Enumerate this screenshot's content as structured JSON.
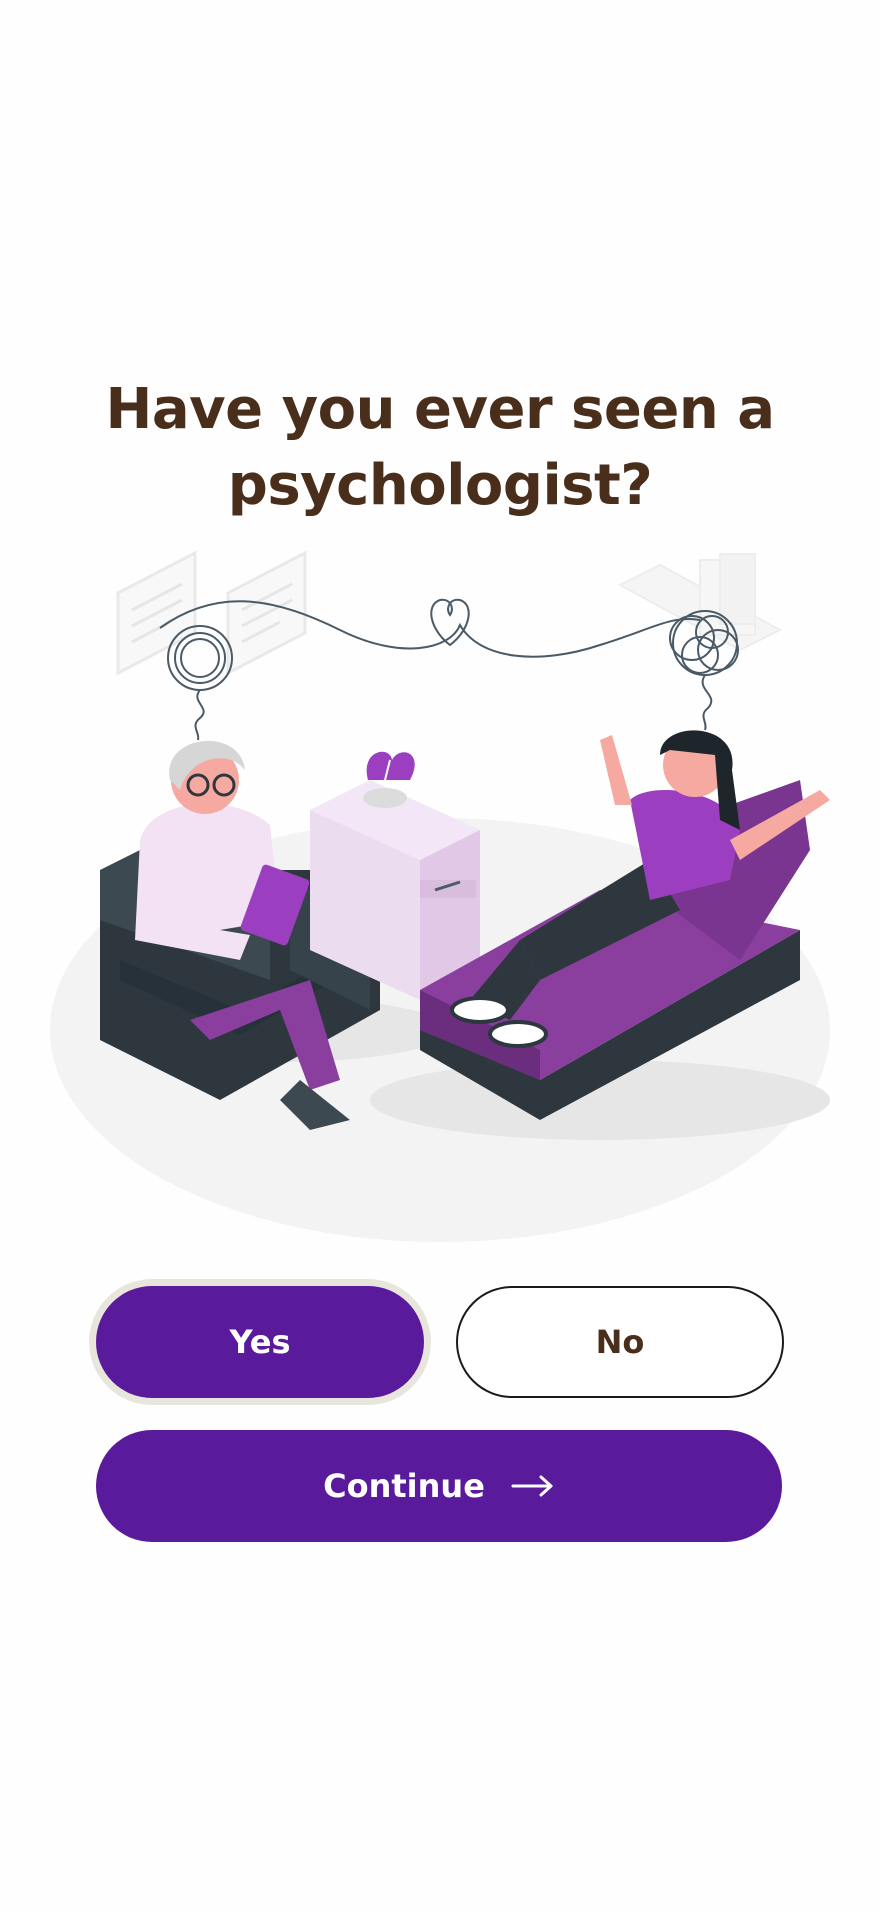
{
  "question": {
    "title": "Have you ever seen a psychologist?"
  },
  "illustration": {
    "name": "therapy-session-illustration"
  },
  "answers": {
    "yes_label": "Yes",
    "no_label": "No",
    "selected": "Yes"
  },
  "continue": {
    "label": "Continue",
    "icon": "arrow-right-icon"
  },
  "colors": {
    "primary": "#5a1a9c",
    "heading": "#4a2e1c",
    "selected_ring": "#e8e6dc"
  }
}
